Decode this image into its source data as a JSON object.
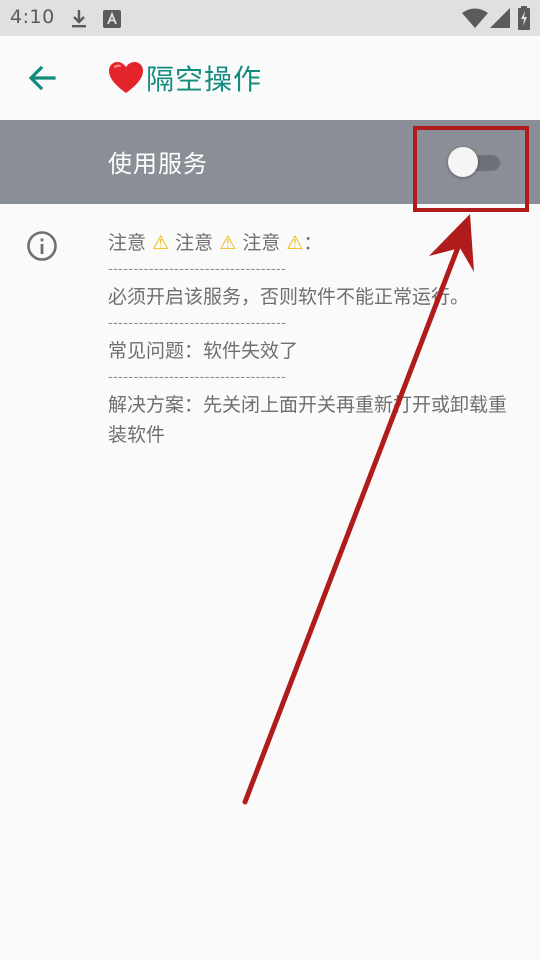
{
  "status_bar": {
    "time": "4:10",
    "icons": [
      "download-icon",
      "font-a-icon",
      "wifi-icon",
      "signal-icon",
      "battery-icon"
    ]
  },
  "app_bar": {
    "back_icon": "arrow-left-icon",
    "title_icon": "heart-icon",
    "title": "隔空操作",
    "title_color": "#128c7e"
  },
  "service": {
    "label": "使用服务",
    "toggle_on": false,
    "row_color": "#8a8e96"
  },
  "notes": {
    "warning_word": "注意",
    "warning_sep": "：",
    "divider": "-----------------------------------",
    "line1": "必须开启该服务，否则软件不能正常运行。",
    "line2": "常见问题：软件失效了",
    "line3": "解决方案：先关闭上面开关再重新打开或卸载重装软件"
  },
  "annotation": {
    "color": "#b01c1c",
    "shapes": [
      "highlight-box",
      "pointer-arrow"
    ]
  }
}
